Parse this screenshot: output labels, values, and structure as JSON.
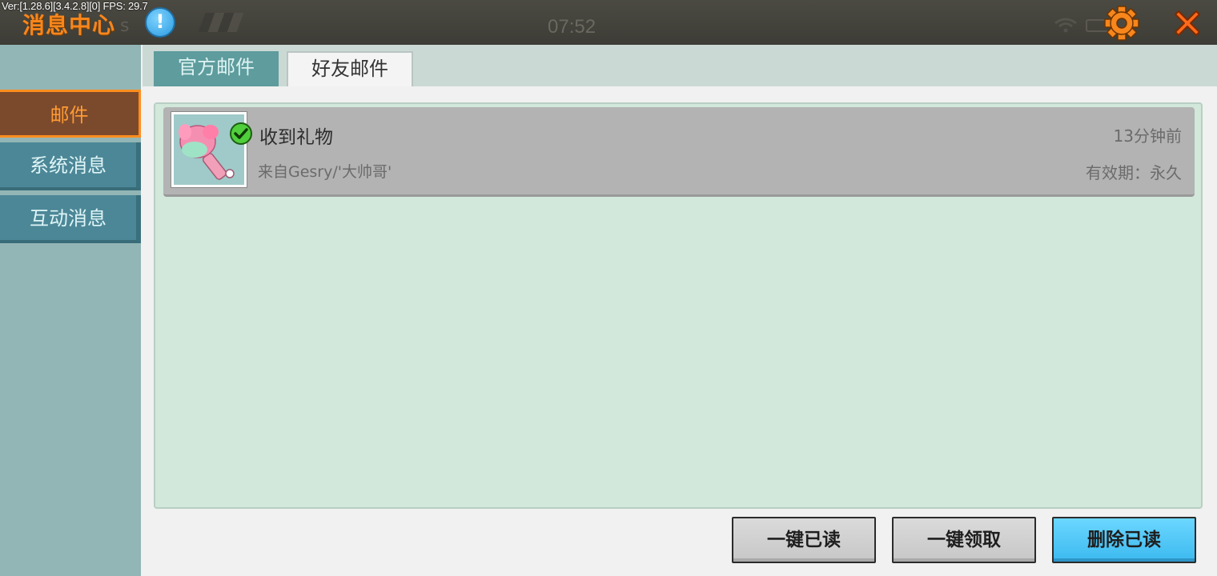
{
  "header": {
    "version_text": "Ver:[1.28.6][3.4.2.8][0] FPS: 29.7",
    "title": "消息中心",
    "background_status_fragment": "s",
    "clock": "07:52",
    "info_icon": "exclamation",
    "settings_icon": "gear-icon",
    "close_icon": "close-icon",
    "accent_color": "#f7861c"
  },
  "sidebar": {
    "items": [
      {
        "label": "邮件",
        "active": true
      },
      {
        "label": "系统消息",
        "active": false
      },
      {
        "label": "互动消息",
        "active": false
      }
    ]
  },
  "tabs": [
    {
      "label": "官方邮件",
      "active": false
    },
    {
      "label": "好友邮件",
      "active": true
    }
  ],
  "mails": [
    {
      "title": "收到礼物",
      "sender": "来自Gesry/'大帅哥'",
      "time": "13分钟前",
      "expiry": "有效期：永久",
      "thumbnail": "gift-item-icon",
      "checked": true
    }
  ],
  "actions": {
    "read_all": "一键已读",
    "claim_all": "一键领取",
    "delete_read": "删除已读"
  }
}
